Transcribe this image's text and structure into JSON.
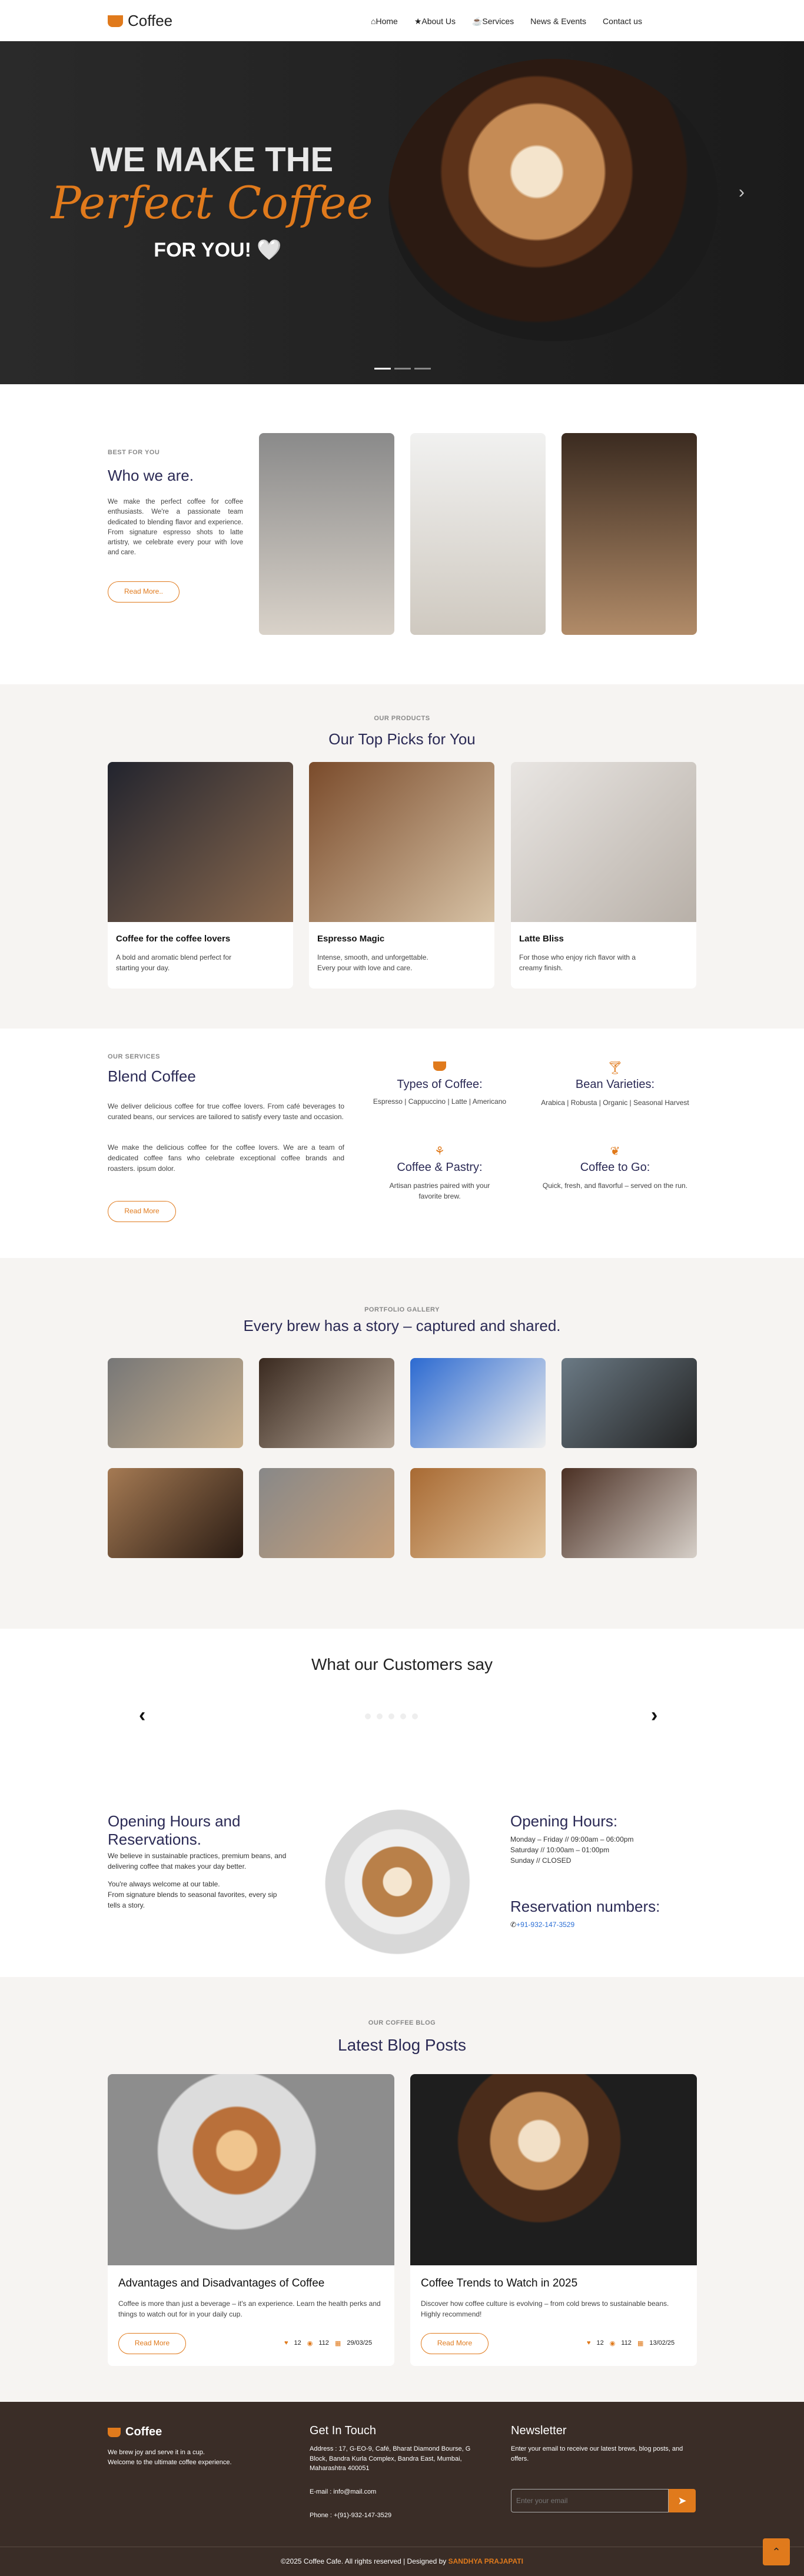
{
  "nav": {
    "brand": "Coffee",
    "links": [
      {
        "icon": "home-icon",
        "label": "Home"
      },
      {
        "icon": "star-icon",
        "label": "About Us"
      },
      {
        "icon": "coffee-icon",
        "label": "Services"
      },
      {
        "label": "News & Events"
      },
      {
        "label": "Contact us"
      }
    ]
  },
  "hero": {
    "line1": "WE MAKE THE",
    "line2": "Perfect Coffee",
    "line3": "FOR YOU! 🤍"
  },
  "about": {
    "eyebrow": "BEST FOR YOU",
    "title": "Who we are.",
    "text": "We make the perfect coffee for coffee enthusiasts. We're a passionate team dedicated to blending flavor and experience. From signature espresso shots to latte artistry, we celebrate every pour with love and care.",
    "button": "Read More.."
  },
  "products": {
    "eyebrow": "OUR PRODUCTS",
    "title": "Our Top Picks for You",
    "items": [
      {
        "name": "Coffee for the coffee lovers",
        "text": "A bold and aromatic blend perfect for starting your day."
      },
      {
        "name": "Espresso Magic",
        "text": "Intense, smooth, and unforgettable. Every pour with love and care."
      },
      {
        "name": "Latte Bliss",
        "text": "For those who enjoy rich flavor with a creamy finish."
      }
    ]
  },
  "services": {
    "eyebrow": "OUR SERVICES",
    "title": "Blend Coffee",
    "p1": "We deliver delicious coffee for true coffee lovers. From café beverages to curated beans, our services are tailored to satisfy every taste and occasion.",
    "p2": "We make the delicious coffee for the coffee lovers. We are a team of dedicated coffee fans who celebrate exceptional coffee brands and roasters. ipsum dolor.",
    "button": "Read More",
    "items": [
      {
        "icon": "coffee-cup-icon",
        "title": "Types of Coffee:",
        "text": "Espresso | Cappuccino | Latte | Americano"
      },
      {
        "icon": "cocktail-glass-icon",
        "title": "Bean Varieties:",
        "text": "Arabica | Robusta | Organic | Seasonal Harvest"
      },
      {
        "icon": "bread-icon",
        "title": "Coffee & Pastry:",
        "text": "Artisan pastries paired with your favorite brew."
      },
      {
        "icon": "leaf-icon",
        "title": "Coffee to Go:",
        "text": "Quick, fresh, and flavorful – served on the run."
      }
    ]
  },
  "gallery": {
    "eyebrow": "PORTFOLIO GALLERY",
    "title": "Every brew has a story – captured and shared."
  },
  "testimonials": {
    "title": "What our Customers say"
  },
  "hours": {
    "title": "Opening Hours and Reservations.",
    "text1": "We believe in sustainable practices, premium beans, and delivering coffee that makes your day better.",
    "text2": "You're always welcome at our table.",
    "text3": "From signature blends to seasonal favorites, every sip tells a story.",
    "hours_title": "Opening Hours:",
    "hours_lines": [
      "Monday – Friday // 09:00am – 06:00pm",
      "Saturday // 10:00am – 01:00pm",
      "Sunday // CLOSED"
    ],
    "res_title": "Reservation numbers:",
    "phone": "+91-932-147-3529"
  },
  "blog": {
    "eyebrow": "OUR COFFEE BLOG",
    "title": "Latest Blog Posts",
    "posts": [
      {
        "title": "Advantages and Disadvantages of Coffee",
        "text": "Coffee is more than just a beverage – it's an experience. Learn the health perks and things to watch out for in your daily cup.",
        "button": "Read More",
        "likes": "12",
        "views": "112",
        "date": "29/03/25"
      },
      {
        "title": "Coffee Trends to Watch in 2025",
        "text": "Discover how coffee culture is evolving – from cold brews to sustainable beans. Highly recommend!",
        "button": "Read More",
        "likes": "12",
        "views": "112",
        "date": "13/02/25"
      }
    ]
  },
  "footer": {
    "brand": "Coffee",
    "about": "We brew joy and serve it in a cup. Welcome to the ultimate coffee experience.",
    "contact_title": "Get In Touch",
    "address": "Address : 17, G-EO-9, Café, Bharat Diamond Bourse, G Block, Bandra Kurla Complex, Bandra East, Mumbai, Maharashtra 400051",
    "email": "E-mail : info@mail.com",
    "phone": "Phone : +(91)-932-147-3529",
    "news_title": "Newsletter",
    "news_text": "Enter your email to receive our latest brews, blog posts, and offers.",
    "placeholder": "Enter your email",
    "copyright": "©2025 Coffee Cafe. All rights reserved | Designed by",
    "designer": "SANDHYA PRAJAPATI"
  },
  "colors": {
    "accent": "#e07a1c",
    "navy": "#2b2a55",
    "footer": "#3a2d27"
  }
}
